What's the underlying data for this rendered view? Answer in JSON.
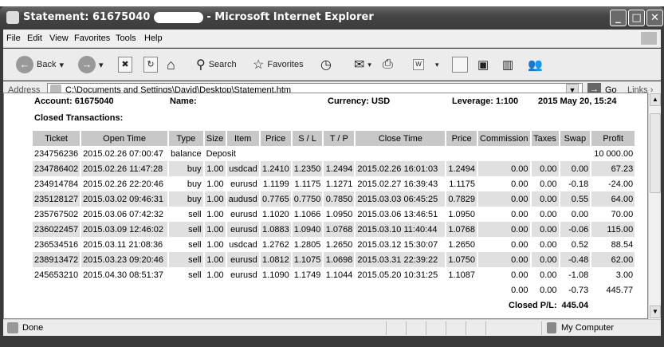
{
  "window": {
    "title_prefix": "Statement: 61675040",
    "title_suffix": " - Microsoft Internet Explorer"
  },
  "menu": [
    "File",
    "Edit",
    "View",
    "Favorites",
    "Tools",
    "Help"
  ],
  "toolbar": {
    "back": "Back",
    "search": "Search",
    "favorites": "Favorites"
  },
  "address": {
    "label": "Address",
    "value": "C:\\Documents and Settings\\David\\Desktop\\Statement.htm",
    "go": "Go",
    "links": "Links"
  },
  "report": {
    "account": "Account: 61675040",
    "name": "Name:",
    "currency": "Currency: USD",
    "leverage": "Leverage: 1:100",
    "date": "2015 May 20, 15:24",
    "section": "Closed Transactions:"
  },
  "columns": [
    "Ticket",
    "Open Time",
    "Type",
    "Size",
    "Item",
    "Price",
    "S / L",
    "T / P",
    "Close Time",
    "Price",
    "Commission",
    "Taxes",
    "Swap",
    "Profit"
  ],
  "deposit": {
    "ticket": "234756236",
    "open_time": "2015.02.26 07:00:47",
    "type": "balance",
    "item": "Deposit",
    "profit": "10 000.00"
  },
  "rows": [
    [
      "234786402",
      "2015.02.26 11:47:28",
      "buy",
      "1.00",
      "usdcad",
      "1.2410",
      "1.2350",
      "1.2494",
      "2015.02.26 16:01:03",
      "1.2494",
      "0.00",
      "0.00",
      "0.00",
      "67.23"
    ],
    [
      "234914784",
      "2015.02.26 22:20:46",
      "buy",
      "1.00",
      "eurusd",
      "1.1199",
      "1.1175",
      "1.1271",
      "2015.02.27 16:39:43",
      "1.1175",
      "0.00",
      "0.00",
      "-0.18",
      "-24.00"
    ],
    [
      "235128127",
      "2015.03.02 09:46:31",
      "buy",
      "1.00",
      "audusd",
      "0.7765",
      "0.7750",
      "0.7850",
      "2015.03.03 06:45:25",
      "0.7829",
      "0.00",
      "0.00",
      "0.55",
      "64.00"
    ],
    [
      "235767502",
      "2015.03.06 07:42:32",
      "sell",
      "1.00",
      "eurusd",
      "1.1020",
      "1.1066",
      "1.0950",
      "2015.03.06 13:46:51",
      "1.0950",
      "0.00",
      "0.00",
      "0.00",
      "70.00"
    ],
    [
      "236022457",
      "2015.03.09 12:46:02",
      "sell",
      "1.00",
      "eurusd",
      "1.0883",
      "1.0940",
      "1.0768",
      "2015.03.10 11:40:44",
      "1.0768",
      "0.00",
      "0.00",
      "-0.06",
      "115.00"
    ],
    [
      "236534516",
      "2015.03.11 21:08:36",
      "sell",
      "1.00",
      "usdcad",
      "1.2762",
      "1.2805",
      "1.2650",
      "2015.03.12 15:30:07",
      "1.2650",
      "0.00",
      "0.00",
      "0.52",
      "88.54"
    ],
    [
      "238913472",
      "2015.03.23 09:20:46",
      "sell",
      "1.00",
      "eurusd",
      "1.0812",
      "1.1075",
      "1.0698",
      "2015.03.31 22:39:22",
      "1.0750",
      "0.00",
      "0.00",
      "-0.48",
      "62.00"
    ],
    [
      "245653210",
      "2015.04.30 08:51:37",
      "sell",
      "1.00",
      "eurusd",
      "1.1090",
      "1.1749",
      "1.1044",
      "2015.05.20 10:31:25",
      "1.1087",
      "0.00",
      "0.00",
      "-1.08",
      "3.00"
    ]
  ],
  "totals": {
    "commission": "0.00",
    "taxes": "0.00",
    "swap": "-0.73",
    "profit": "445.77"
  },
  "closed_pl": {
    "label": "Closed P/L:",
    "value": "445.04"
  },
  "status": {
    "text": "Done",
    "zone": "My Computer"
  }
}
